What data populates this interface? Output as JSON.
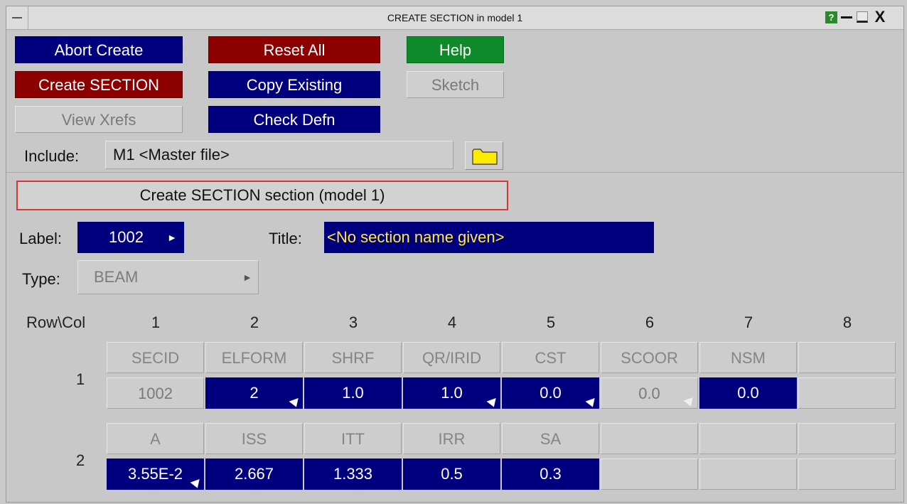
{
  "window": {
    "title": "CREATE SECTION in model 1",
    "help_glyph": "?",
    "close_glyph": "X"
  },
  "buttons": {
    "abort_create": "Abort Create",
    "reset_all": "Reset All",
    "help": "Help",
    "create_section": "Create SECTION",
    "copy_existing": "Copy Existing",
    "sketch": "Sketch",
    "view_xrefs": "View Xrefs",
    "check_defn": "Check Defn"
  },
  "include": {
    "label": "Include:",
    "value": "M1  <Master file>"
  },
  "banner": "Create SECTION section (model 1)",
  "fields": {
    "label_caption": "Label:",
    "label_value": "1002",
    "title_caption": "Title:",
    "title_value": "<No section name given>",
    "type_caption": "Type:",
    "type_value": "BEAM"
  },
  "grid": {
    "corner": "Row\\Col",
    "columns": [
      "1",
      "2",
      "3",
      "4",
      "5",
      "6",
      "7",
      "8"
    ],
    "rows": [
      {
        "label": "1",
        "headers": [
          "SECID",
          "ELFORM",
          "SHRF",
          "QR/IRID",
          "CST",
          "SCOOR",
          "NSM",
          ""
        ],
        "values": [
          "1002",
          "2",
          "1.0",
          "1.0",
          "0.0",
          "0.0",
          "0.0",
          ""
        ]
      },
      {
        "label": "2",
        "headers": [
          "A",
          "ISS",
          "ITT",
          "IRR",
          "SA",
          "",
          "",
          ""
        ],
        "values": [
          "3.55E-2",
          "2.667",
          "1.333",
          "0.5",
          "0.3",
          "",
          "",
          ""
        ]
      }
    ]
  }
}
